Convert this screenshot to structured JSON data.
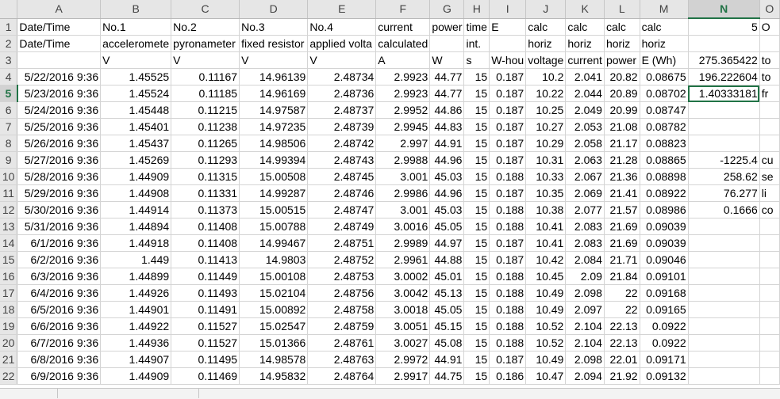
{
  "columns": [
    "A",
    "B",
    "C",
    "D",
    "E",
    "F",
    "G",
    "H",
    "I",
    "J",
    "K",
    "L",
    "M",
    "N",
    "O"
  ],
  "selected_column": "N",
  "selected_row": 5,
  "rows": [
    {
      "n": 1,
      "cells": [
        "Date/Time",
        "No.1",
        "No.2",
        "No.3",
        "No.4",
        "current",
        "power",
        "time",
        "E",
        "calc",
        "calc",
        "calc",
        "calc",
        "5",
        "O"
      ]
    },
    {
      "n": 2,
      "cells": [
        "Date/Time",
        "acceleromete",
        "pyronameter",
        "fixed resistor",
        "applied volta",
        "calculated",
        "",
        "int.",
        "",
        "horiz",
        "horiz",
        "horiz",
        "horiz",
        "",
        ""
      ]
    },
    {
      "n": 3,
      "cells": [
        "",
        "V",
        "V",
        "V",
        "V",
        "A",
        "W",
        "s",
        "W-hou",
        "voltage",
        "current",
        "power",
        "E (Wh)",
        "275.365422",
        "to"
      ]
    },
    {
      "n": 4,
      "cells": [
        "5/22/2016 9:36",
        "1.45525",
        "0.11167",
        "14.96139",
        "2.48734",
        "2.9923",
        "44.77",
        "15",
        "0.187",
        "10.2",
        "2.041",
        "20.82",
        "0.08675",
        "196.222604",
        "to"
      ]
    },
    {
      "n": 5,
      "cells": [
        "5/23/2016 9:36",
        "1.45524",
        "0.11185",
        "14.96169",
        "2.48736",
        "2.9923",
        "44.77",
        "15",
        "0.187",
        "10.22",
        "2.044",
        "20.89",
        "0.08702",
        "1.40333181",
        "fr"
      ]
    },
    {
      "n": 6,
      "cells": [
        "5/24/2016 9:36",
        "1.45448",
        "0.11215",
        "14.97587",
        "2.48737",
        "2.9952",
        "44.86",
        "15",
        "0.187",
        "10.25",
        "2.049",
        "20.99",
        "0.08747",
        "",
        ""
      ]
    },
    {
      "n": 7,
      "cells": [
        "5/25/2016 9:36",
        "1.45401",
        "0.11238",
        "14.97235",
        "2.48739",
        "2.9945",
        "44.83",
        "15",
        "0.187",
        "10.27",
        "2.053",
        "21.08",
        "0.08782",
        "",
        ""
      ]
    },
    {
      "n": 8,
      "cells": [
        "5/26/2016 9:36",
        "1.45437",
        "0.11265",
        "14.98506",
        "2.48742",
        "2.997",
        "44.91",
        "15",
        "0.187",
        "10.29",
        "2.058",
        "21.17",
        "0.08823",
        "",
        ""
      ]
    },
    {
      "n": 9,
      "cells": [
        "5/27/2016 9:36",
        "1.45269",
        "0.11293",
        "14.99394",
        "2.48743",
        "2.9988",
        "44.96",
        "15",
        "0.187",
        "10.31",
        "2.063",
        "21.28",
        "0.08865",
        "-1225.4",
        "cu"
      ]
    },
    {
      "n": 10,
      "cells": [
        "5/28/2016 9:36",
        "1.44909",
        "0.11315",
        "15.00508",
        "2.48745",
        "3.001",
        "45.03",
        "15",
        "0.188",
        "10.33",
        "2.067",
        "21.36",
        "0.08898",
        "258.62",
        "se"
      ]
    },
    {
      "n": 11,
      "cells": [
        "5/29/2016 9:36",
        "1.44908",
        "0.11331",
        "14.99287",
        "2.48746",
        "2.9986",
        "44.96",
        "15",
        "0.187",
        "10.35",
        "2.069",
        "21.41",
        "0.08922",
        "76.277",
        "li"
      ]
    },
    {
      "n": 12,
      "cells": [
        "5/30/2016 9:36",
        "1.44914",
        "0.11373",
        "15.00515",
        "2.48747",
        "3.001",
        "45.03",
        "15",
        "0.188",
        "10.38",
        "2.077",
        "21.57",
        "0.08986",
        "0.1666",
        "co"
      ]
    },
    {
      "n": 13,
      "cells": [
        "5/31/2016 9:36",
        "1.44894",
        "0.11408",
        "15.00788",
        "2.48749",
        "3.0016",
        "45.05",
        "15",
        "0.188",
        "10.41",
        "2.083",
        "21.69",
        "0.09039",
        "",
        ""
      ]
    },
    {
      "n": 14,
      "cells": [
        "6/1/2016 9:36",
        "1.44918",
        "0.11408",
        "14.99467",
        "2.48751",
        "2.9989",
        "44.97",
        "15",
        "0.187",
        "10.41",
        "2.083",
        "21.69",
        "0.09039",
        "",
        ""
      ]
    },
    {
      "n": 15,
      "cells": [
        "6/2/2016 9:36",
        "1.449",
        "0.11413",
        "14.9803",
        "2.48752",
        "2.9961",
        "44.88",
        "15",
        "0.187",
        "10.42",
        "2.084",
        "21.71",
        "0.09046",
        "",
        ""
      ]
    },
    {
      "n": 16,
      "cells": [
        "6/3/2016 9:36",
        "1.44899",
        "0.11449",
        "15.00108",
        "2.48753",
        "3.0002",
        "45.01",
        "15",
        "0.188",
        "10.45",
        "2.09",
        "21.84",
        "0.09101",
        "",
        ""
      ]
    },
    {
      "n": 17,
      "cells": [
        "6/4/2016 9:36",
        "1.44926",
        "0.11493",
        "15.02104",
        "2.48756",
        "3.0042",
        "45.13",
        "15",
        "0.188",
        "10.49",
        "2.098",
        "22",
        "0.09168",
        "",
        ""
      ]
    },
    {
      "n": 18,
      "cells": [
        "6/5/2016 9:36",
        "1.44901",
        "0.11491",
        "15.00892",
        "2.48758",
        "3.0018",
        "45.05",
        "15",
        "0.188",
        "10.49",
        "2.097",
        "22",
        "0.09165",
        "",
        ""
      ]
    },
    {
      "n": 19,
      "cells": [
        "6/6/2016 9:36",
        "1.44922",
        "0.11527",
        "15.02547",
        "2.48759",
        "3.0051",
        "45.15",
        "15",
        "0.188",
        "10.52",
        "2.104",
        "22.13",
        "0.0922",
        "",
        ""
      ]
    },
    {
      "n": 20,
      "cells": [
        "6/7/2016 9:36",
        "1.44936",
        "0.11527",
        "15.01366",
        "2.48761",
        "3.0027",
        "45.08",
        "15",
        "0.188",
        "10.52",
        "2.104",
        "22.13",
        "0.0922",
        "",
        ""
      ]
    },
    {
      "n": 21,
      "cells": [
        "6/8/2016 9:36",
        "1.44907",
        "0.11495",
        "14.98578",
        "2.48763",
        "2.9972",
        "44.91",
        "15",
        "0.187",
        "10.49",
        "2.098",
        "22.01",
        "0.09171",
        "",
        ""
      ]
    },
    {
      "n": 22,
      "cells": [
        "6/9/2016 9:36",
        "1.44909",
        "0.11469",
        "14.95832",
        "2.48764",
        "2.9917",
        "44.75",
        "15",
        "0.186",
        "10.47",
        "2.094",
        "21.92",
        "0.09132",
        "",
        ""
      ]
    }
  ]
}
